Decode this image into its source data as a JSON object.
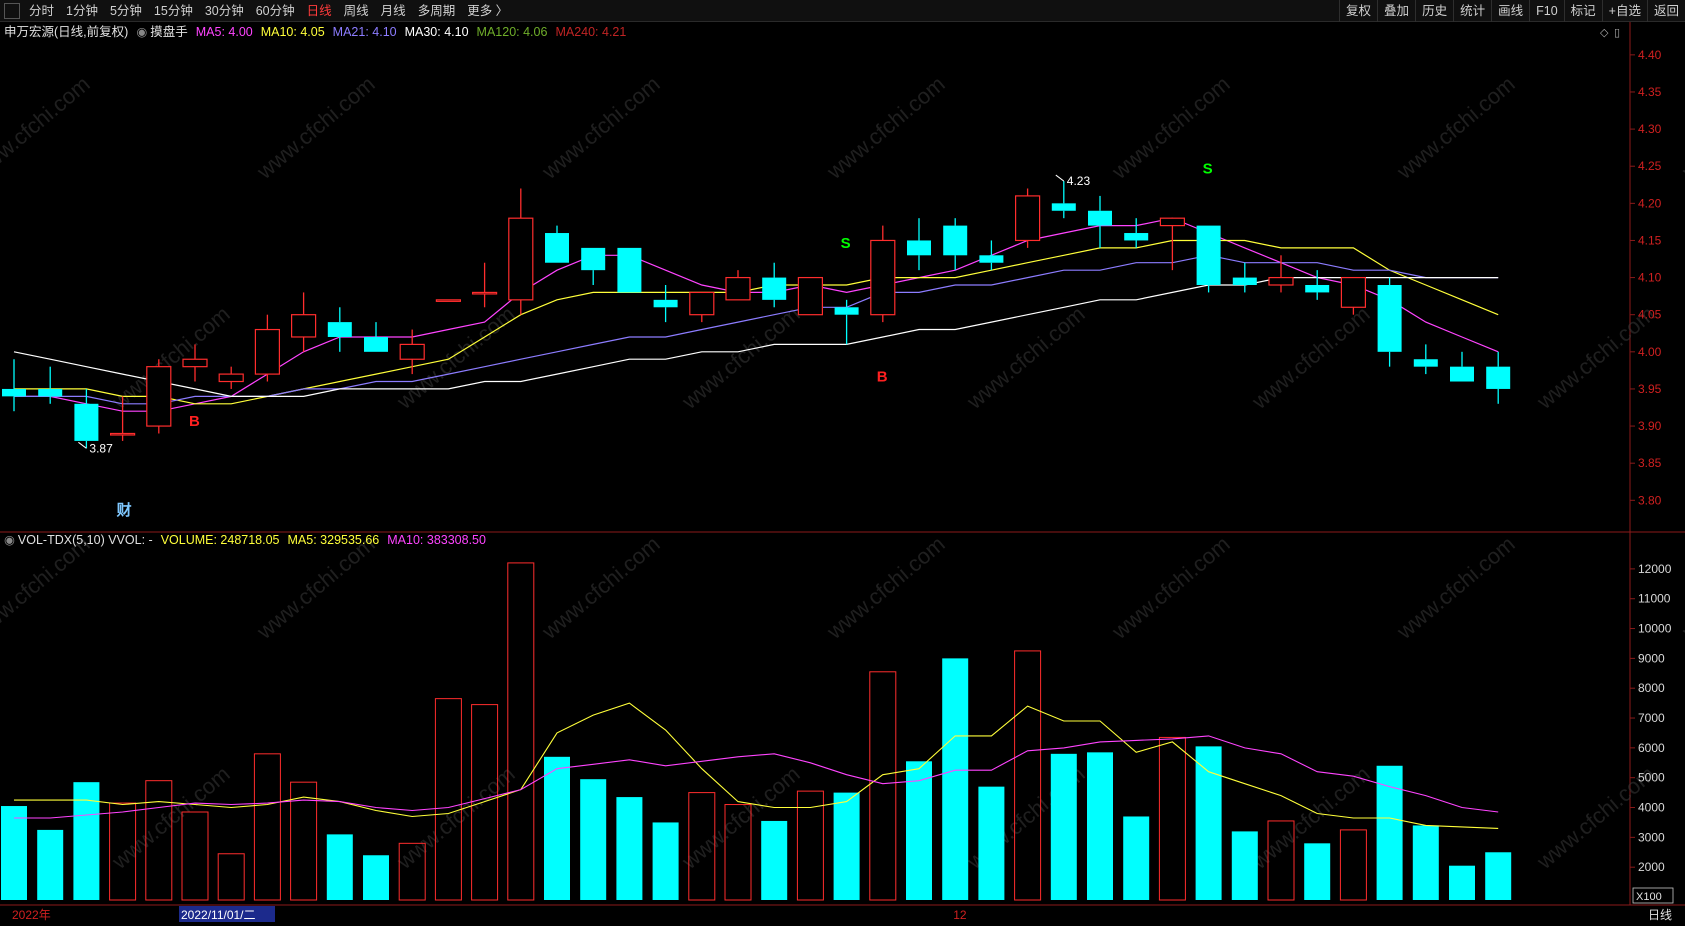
{
  "toolbar": {
    "periods": [
      "分时",
      "1分钟",
      "5分钟",
      "15分钟",
      "30分钟",
      "60分钟",
      "日线",
      "周线",
      "月线",
      "多周期",
      "更多 〉"
    ],
    "active_period": "日线",
    "right_buttons": [
      "复权",
      "叠加",
      "历史",
      "统计",
      "画线",
      "F10",
      "标记",
      "+自选",
      "返回"
    ]
  },
  "price_header": {
    "security": "申万宏源(日线,前复权)",
    "indicator": "摸盘手",
    "items": [
      {
        "label": "MA5: 4.00",
        "color": "#ff44ff"
      },
      {
        "label": "MA10: 4.05",
        "color": "#ffff3a"
      },
      {
        "label": "MA21: 4.10",
        "color": "#8c7cff"
      },
      {
        "label": "MA30: 4.10",
        "color": "#ffffff"
      },
      {
        "label": "MA120: 4.06",
        "color": "#6fae2a"
      },
      {
        "label": "MA240: 4.21",
        "color": "#c02424"
      }
    ]
  },
  "volume_header": {
    "label": "VOL-TDX(5,10) VVOL: -",
    "items": [
      {
        "label": "VOLUME: 248718.05",
        "color": "#ffff3a"
      },
      {
        "label": "MA5: 329535.66",
        "color": "#ffff3a"
      },
      {
        "label": "MA10: 383308.50",
        "color": "#ff44ff"
      }
    ]
  },
  "chart_data": [
    {
      "type": "candlestick",
      "title": "申万宏源(日线,前复权)",
      "ylim": [
        3.76,
        4.42
      ],
      "y_ticks": [
        "4.40",
        "4.35",
        "4.30",
        "4.25",
        "4.20",
        "4.15",
        "4.10",
        "4.05",
        "4.00",
        "3.95",
        "3.90",
        "3.85",
        "3.80"
      ],
      "candles": [
        {
          "o": 3.95,
          "h": 3.99,
          "l": 3.92,
          "c": 3.94
        },
        {
          "o": 3.95,
          "h": 3.98,
          "l": 3.93,
          "c": 3.94
        },
        {
          "o": 3.93,
          "h": 3.95,
          "l": 3.87,
          "c": 3.88
        },
        {
          "o": 3.89,
          "h": 3.94,
          "l": 3.88,
          "c": 3.89
        },
        {
          "o": 3.9,
          "h": 3.99,
          "l": 3.89,
          "c": 3.98
        },
        {
          "o": 3.98,
          "h": 4.01,
          "l": 3.96,
          "c": 3.99
        },
        {
          "o": 3.96,
          "h": 3.98,
          "l": 3.95,
          "c": 3.97
        },
        {
          "o": 3.97,
          "h": 4.05,
          "l": 3.96,
          "c": 4.03
        },
        {
          "o": 4.02,
          "h": 4.08,
          "l": 4.0,
          "c": 4.05
        },
        {
          "o": 4.04,
          "h": 4.06,
          "l": 4.0,
          "c": 4.02
        },
        {
          "o": 4.02,
          "h": 4.04,
          "l": 4.0,
          "c": 4.0
        },
        {
          "o": 3.99,
          "h": 4.03,
          "l": 3.97,
          "c": 4.01
        },
        {
          "o": 4.07,
          "h": 4.07,
          "l": 4.07,
          "c": 4.07
        },
        {
          "o": 4.08,
          "h": 4.12,
          "l": 4.06,
          "c": 4.08
        },
        {
          "o": 4.07,
          "h": 4.22,
          "l": 4.05,
          "c": 4.18
        },
        {
          "o": 4.16,
          "h": 4.17,
          "l": 4.12,
          "c": 4.12
        },
        {
          "o": 4.14,
          "h": 4.14,
          "l": 4.09,
          "c": 4.11
        },
        {
          "o": 4.14,
          "h": 4.14,
          "l": 4.08,
          "c": 4.08
        },
        {
          "o": 4.07,
          "h": 4.09,
          "l": 4.04,
          "c": 4.06
        },
        {
          "o": 4.05,
          "h": 4.08,
          "l": 4.04,
          "c": 4.08
        },
        {
          "o": 4.07,
          "h": 4.11,
          "l": 4.07,
          "c": 4.1
        },
        {
          "o": 4.1,
          "h": 4.12,
          "l": 4.06,
          "c": 4.07
        },
        {
          "o": 4.05,
          "h": 4.1,
          "l": 4.05,
          "c": 4.1
        },
        {
          "o": 4.06,
          "h": 4.07,
          "l": 4.01,
          "c": 4.05
        },
        {
          "o": 4.05,
          "h": 4.17,
          "l": 4.04,
          "c": 4.15
        },
        {
          "o": 4.15,
          "h": 4.18,
          "l": 4.11,
          "c": 4.13
        },
        {
          "o": 4.17,
          "h": 4.18,
          "l": 4.11,
          "c": 4.13
        },
        {
          "o": 4.13,
          "h": 4.15,
          "l": 4.11,
          "c": 4.12
        },
        {
          "o": 4.15,
          "h": 4.22,
          "l": 4.14,
          "c": 4.21
        },
        {
          "o": 4.2,
          "h": 4.23,
          "l": 4.18,
          "c": 4.19
        },
        {
          "o": 4.19,
          "h": 4.21,
          "l": 4.14,
          "c": 4.17
        },
        {
          "o": 4.16,
          "h": 4.18,
          "l": 4.14,
          "c": 4.15
        },
        {
          "o": 4.17,
          "h": 4.18,
          "l": 4.11,
          "c": 4.18
        },
        {
          "o": 4.17,
          "h": 4.17,
          "l": 4.08,
          "c": 4.09
        },
        {
          "o": 4.1,
          "h": 4.12,
          "l": 4.08,
          "c": 4.09
        },
        {
          "o": 4.09,
          "h": 4.13,
          "l": 4.08,
          "c": 4.1
        },
        {
          "o": 4.09,
          "h": 4.11,
          "l": 4.07,
          "c": 4.08
        },
        {
          "o": 4.06,
          "h": 4.1,
          "l": 4.05,
          "c": 4.1
        },
        {
          "o": 4.09,
          "h": 4.1,
          "l": 3.98,
          "c": 4.0
        },
        {
          "o": 3.99,
          "h": 4.01,
          "l": 3.97,
          "c": 3.98
        },
        {
          "o": 3.98,
          "h": 4.0,
          "l": 3.96,
          "c": 3.96
        },
        {
          "o": 3.98,
          "h": 4.0,
          "l": 3.93,
          "c": 3.95
        }
      ],
      "series": [
        {
          "name": "MA5",
          "color": "#ff44ff",
          "values": [
            3.94,
            3.94,
            3.93,
            3.92,
            3.92,
            3.93,
            3.94,
            3.97,
            4.0,
            4.02,
            4.02,
            4.02,
            4.03,
            4.04,
            4.08,
            4.11,
            4.13,
            4.13,
            4.11,
            4.09,
            4.08,
            4.08,
            4.09,
            4.08,
            4.09,
            4.1,
            4.11,
            4.13,
            4.15,
            4.16,
            4.17,
            4.17,
            4.18,
            4.16,
            4.14,
            4.12,
            4.1,
            4.09,
            4.07,
            4.04,
            4.02,
            4.0
          ]
        },
        {
          "name": "MA10",
          "color": "#ffff3a",
          "values": [
            3.95,
            3.95,
            3.95,
            3.94,
            3.94,
            3.93,
            3.93,
            3.94,
            3.95,
            3.96,
            3.97,
            3.98,
            3.99,
            4.02,
            4.05,
            4.07,
            4.08,
            4.08,
            4.08,
            4.08,
            4.08,
            4.09,
            4.09,
            4.09,
            4.1,
            4.1,
            4.1,
            4.11,
            4.12,
            4.13,
            4.14,
            4.14,
            4.15,
            4.15,
            4.15,
            4.14,
            4.14,
            4.14,
            4.11,
            4.09,
            4.07,
            4.05
          ]
        },
        {
          "name": "MA21",
          "color": "#8c7cff",
          "values": [
            3.94,
            3.94,
            3.94,
            3.93,
            3.93,
            3.94,
            3.94,
            3.94,
            3.95,
            3.95,
            3.96,
            3.96,
            3.97,
            3.98,
            3.99,
            4.0,
            4.01,
            4.02,
            4.02,
            4.03,
            4.04,
            4.05,
            4.06,
            4.06,
            4.08,
            4.08,
            4.09,
            4.09,
            4.1,
            4.11,
            4.11,
            4.12,
            4.12,
            4.13,
            4.12,
            4.12,
            4.12,
            4.11,
            4.11,
            4.1,
            4.1,
            4.1
          ]
        },
        {
          "name": "MA30",
          "color": "#ffffff",
          "values": [
            4.0,
            3.99,
            3.98,
            3.97,
            3.96,
            3.95,
            3.94,
            3.94,
            3.94,
            3.95,
            3.95,
            3.95,
            3.95,
            3.96,
            3.96,
            3.97,
            3.98,
            3.99,
            3.99,
            4.0,
            4.0,
            4.01,
            4.01,
            4.01,
            4.02,
            4.03,
            4.03,
            4.04,
            4.05,
            4.06,
            4.07,
            4.07,
            4.08,
            4.09,
            4.09,
            4.1,
            4.1,
            4.1,
            4.1,
            4.1,
            4.1,
            4.1
          ]
        }
      ],
      "annotations": [
        {
          "text": "3.87",
          "index": 2,
          "y": 3.87,
          "color": "#ffffff"
        },
        {
          "text": "4.23",
          "index": 29,
          "y": 4.23,
          "color": "#ffffff"
        },
        {
          "text": "B",
          "index": 5,
          "y": 3.9,
          "color": "#ff2020"
        },
        {
          "text": "S",
          "index": 23,
          "y": 4.14,
          "color": "#00ff00"
        },
        {
          "text": "B",
          "index": 24,
          "y": 3.96,
          "color": "#ff2020"
        },
        {
          "text": "S",
          "index": 33,
          "y": 4.24,
          "color": "#00ff00"
        },
        {
          "text": "财",
          "index": 3,
          "y": 3.78,
          "color": "#7fc8ff"
        }
      ],
      "x_labels": [
        {
          "text": "2022年",
          "index": 0
        },
        {
          "text": "2022/11/01/二",
          "index": 5,
          "highlight": true
        },
        {
          "text": "12",
          "index": 26
        }
      ]
    },
    {
      "type": "bar",
      "title": "VOL-TDX(5,10)",
      "unit": "X100",
      "ylim": [
        900,
        12700
      ],
      "y_ticks": [
        "12000",
        "11000",
        "10000",
        "9000",
        "8000",
        "7000",
        "6000",
        "5000",
        "4000",
        "3000",
        "2000"
      ],
      "values": [
        4050,
        3250,
        4850,
        4150,
        4900,
        3850,
        2450,
        5800,
        4850,
        3100,
        2400,
        2800,
        7650,
        7450,
        12200,
        5700,
        4950,
        4350,
        3500,
        4500,
        4100,
        3550,
        4550,
        4500,
        8550,
        5550,
        9000,
        4700,
        9250,
        5800,
        5850,
        3700,
        6350,
        6050,
        3200,
        3550,
        2800,
        3250,
        5400,
        3400,
        2050,
        2500
      ],
      "series": [
        {
          "name": "MA5",
          "color": "#ffff3a",
          "values": [
            4250,
            4250,
            4250,
            4100,
            4200,
            4100,
            4000,
            4100,
            4350,
            4200,
            3900,
            3700,
            3800,
            4200,
            4600,
            6500,
            7100,
            7500,
            6600,
            5300,
            4200,
            4000,
            4000,
            4200,
            5100,
            5300,
            6400,
            6400,
            7400,
            6900,
            6900,
            5850,
            6200,
            5200,
            4800,
            4400,
            3800,
            3650,
            3650,
            3400,
            3350,
            3300
          ]
        },
        {
          "name": "MA10",
          "color": "#ff44ff",
          "values": [
            3650,
            3650,
            3750,
            3850,
            4000,
            4150,
            4100,
            4150,
            4250,
            4200,
            4000,
            3900,
            4000,
            4300,
            4600,
            5300,
            5450,
            5600,
            5400,
            5550,
            5700,
            5800,
            5500,
            5100,
            4800,
            4900,
            5250,
            5250,
            5900,
            6000,
            6200,
            6250,
            6300,
            6400,
            6000,
            5800,
            5200,
            5050,
            4700,
            4400,
            4000,
            3850
          ]
        }
      ]
    }
  ],
  "watermark": "www.cfchi.com",
  "colors": {
    "up": "#ff2d2d",
    "down": "#00ffff",
    "frame": "#8b1a1a",
    "axis_text": "#d02020",
    "grid": "#3a0c0c"
  }
}
